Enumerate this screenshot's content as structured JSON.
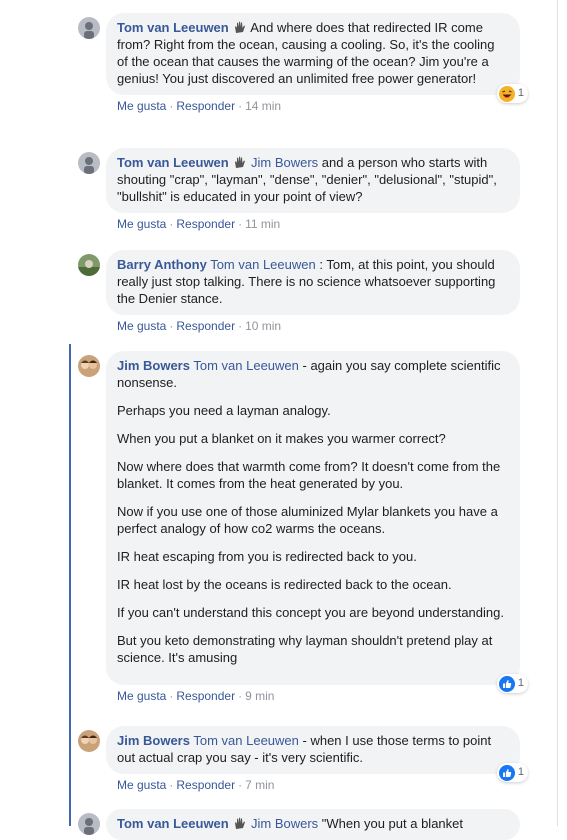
{
  "comments": [
    {
      "author": "Tom van Leeuwen",
      "mention": "",
      "text": "And where does that redirected IR come from? Right from the ocean, causing a cooling. So, it's the cooling of the ocean that causes the warming of the ocean? Jim you're a genius! You just discovered an unlimited free power generator!",
      "like": "Me gusta",
      "reply": "Responder",
      "time": "14 min",
      "reaction": {
        "icon": "laugh-emoji-icon",
        "count": "1"
      }
    },
    {
      "author": "Tom van Leeuwen",
      "mention": "Jim Bowers",
      "text": "and a person who starts with shouting \"crap\", \"layman\", \"dense\", \"denier\", \"delusional\", \"stupid\", \"bullshit\" is educated in your point of view?",
      "like": "Me gusta",
      "reply": "Responder",
      "time": "11 min"
    },
    {
      "author": "Barry Anthony",
      "mention": "Tom van Leeuwen",
      "text": ": Tom, at this point, you should really just stop talking. There is no science whatsoever supporting the Denier stance.",
      "like": "Me gusta",
      "reply": "Responder",
      "time": "10 min"
    },
    {
      "author": "Jim Bowers",
      "mention": "Tom van Leeuwen",
      "first": "- again you say complete scientific nonsense.",
      "paragraphs": [
        "Perhaps you need a layman analogy.",
        "When you put a blanket on it makes you warmer correct?",
        "Now where does that warmth come from? It doesn't come from the blanket. It comes from the heat generated by you.",
        "Now if you use one of those aluminized Mylar blankets you have a perfect analogy of how co2 warms the oceans.",
        "IR heat escaping from you is redirected back to you.",
        "IR heat lost by the oceans is redirected back to the ocean.",
        "If you can't understand this concept you are beyond understanding.",
        "But you keto demonstrating why layman shouldn't pretend play at science. It's amusing"
      ],
      "like": "Me gusta",
      "reply": "Responder",
      "time": "9 min",
      "reaction": {
        "icon": "like-thumb-icon",
        "count": "1"
      }
    },
    {
      "author": "Jim Bowers",
      "mention": "Tom van Leeuwen",
      "text": "- when I use those terms to point out actual crap you say - it's very scientific.",
      "like": "Me gusta",
      "reply": "Responder",
      "time": "7 min",
      "reaction": {
        "icon": "like-thumb-icon",
        "count": "1"
      }
    },
    {
      "author": "Tom van Leeuwen",
      "mention": "Jim Bowers",
      "text": "\"When you put a blanket"
    }
  ],
  "colors": {
    "author": "#385898",
    "bubble": "#f2f3f5",
    "thread_line": "#4267b2"
  }
}
